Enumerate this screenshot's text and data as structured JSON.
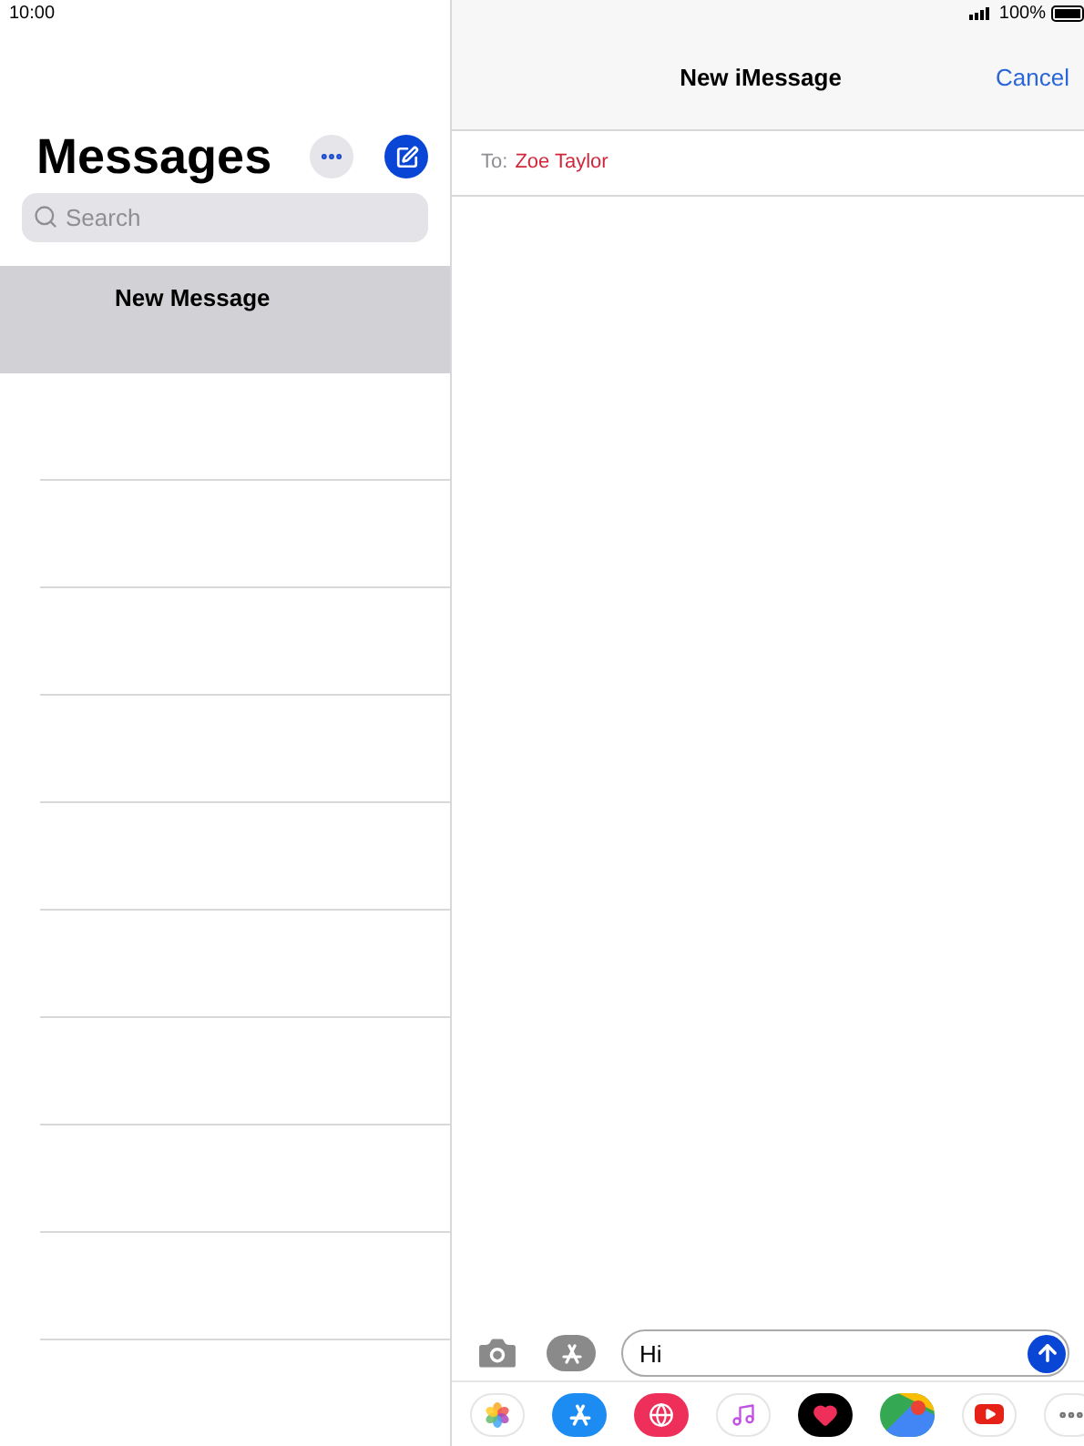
{
  "status_bar": {
    "time": "10:00",
    "battery": "100%"
  },
  "sidebar": {
    "title": "Messages",
    "search": {
      "placeholder": "Search"
    },
    "conversations": [
      {
        "title": "New Message",
        "selected": true
      }
    ]
  },
  "compose": {
    "title": "New iMessage",
    "cancel": "Cancel",
    "to_label": "To:",
    "recipient": "Zoe Taylor",
    "message": {
      "value": "Hi"
    }
  }
}
